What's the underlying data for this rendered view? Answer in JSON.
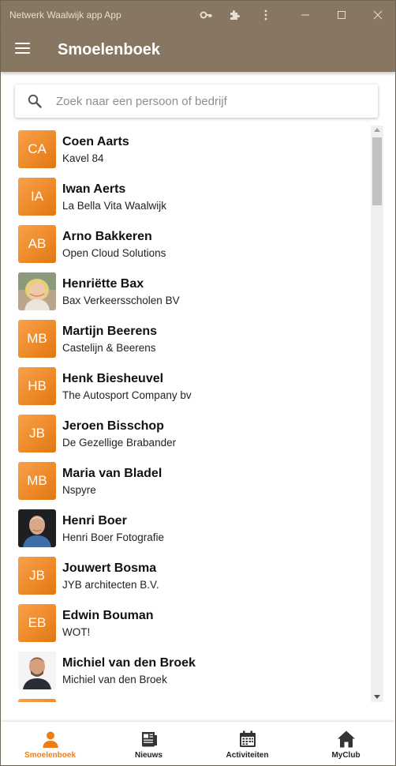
{
  "window": {
    "title": "Netwerk Waalwijk app App"
  },
  "appbar": {
    "title": "Smoelenboek"
  },
  "search": {
    "placeholder": "Zoek naar een persoon of bedrijf"
  },
  "colors": {
    "brand": "#877762",
    "accent": "#ef7d14"
  },
  "contacts": [
    {
      "initials": "CA",
      "name": "Coen Aarts",
      "company": "Kavel 84",
      "photo": false
    },
    {
      "initials": "IA",
      "name": "Iwan Aerts",
      "company": "La Bella Vita Waalwijk",
      "photo": false
    },
    {
      "initials": "AB",
      "name": "Arno Bakkeren",
      "company": "Open Cloud Solutions",
      "photo": false
    },
    {
      "initials": "",
      "name": "Henriëtte Bax",
      "company": "Bax Verkeersscholen BV",
      "photo": true
    },
    {
      "initials": "MB",
      "name": "Martijn Beerens",
      "company": "Castelijn & Beerens",
      "photo": false
    },
    {
      "initials": "HB",
      "name": "Henk Biesheuvel",
      "company": "The Autosport Company bv",
      "photo": false
    },
    {
      "initials": "JB",
      "name": "Jeroen Bisschop",
      "company": "De Gezellige Brabander",
      "photo": false
    },
    {
      "initials": "MB",
      "name": "Maria van Bladel",
      "company": "Nspyre",
      "photo": false
    },
    {
      "initials": "",
      "name": "Henri Boer",
      "company": "Henri Boer Fotografie",
      "photo": true
    },
    {
      "initials": "JB",
      "name": "Jouwert Bosma",
      "company": "JYB architecten B.V.",
      "photo": false
    },
    {
      "initials": "EB",
      "name": "Edwin Bouman",
      "company": "WOT!",
      "photo": false
    },
    {
      "initials": "",
      "name": "Michiel van den Broek",
      "company": "Michiel van den Broek",
      "photo": true
    }
  ],
  "nav": {
    "items": [
      {
        "label": "Smoelenboek",
        "icon": "person-icon",
        "active": true
      },
      {
        "label": "Nieuws",
        "icon": "newspaper-icon",
        "active": false
      },
      {
        "label": "Activiteiten",
        "icon": "calendar-icon",
        "active": false
      },
      {
        "label": "MyClub",
        "icon": "home-icon",
        "active": false
      }
    ]
  }
}
